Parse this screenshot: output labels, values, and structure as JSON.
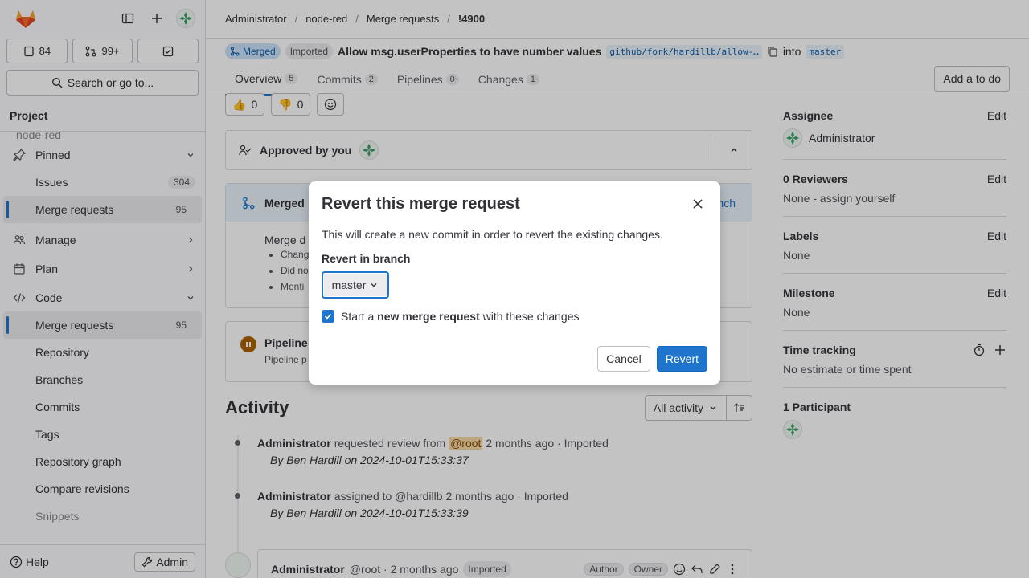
{
  "sidebar": {
    "counts": {
      "issues": "84",
      "merge_requests": "99+"
    },
    "search_label": "Search or go to...",
    "section": "Project",
    "faded_project": "node-red",
    "items": [
      {
        "label": "Pinned"
      },
      {
        "label": "Issues",
        "badge": "304"
      },
      {
        "label": "Merge requests",
        "badge": "95"
      },
      {
        "label": "Manage"
      },
      {
        "label": "Plan"
      },
      {
        "label": "Code"
      },
      {
        "label": "Merge requests",
        "badge": "95"
      },
      {
        "label": "Repository"
      },
      {
        "label": "Branches"
      },
      {
        "label": "Commits"
      },
      {
        "label": "Tags"
      },
      {
        "label": "Repository graph"
      },
      {
        "label": "Compare revisions"
      },
      {
        "label": "Snippets"
      }
    ],
    "help": "Help",
    "admin": "Admin"
  },
  "breadcrumb": [
    "Administrator",
    "node-red",
    "Merge requests",
    "!4900"
  ],
  "mr": {
    "status": "Merged",
    "imported": "Imported",
    "title": "Allow msg.userProperties to have number values",
    "source_branch": "github/fork/hardillb/allow-…",
    "into": "into",
    "target_branch": "master"
  },
  "tabs": [
    {
      "label": "Overview",
      "count": "5"
    },
    {
      "label": "Commits",
      "count": "2"
    },
    {
      "label": "Pipelines",
      "count": "0"
    },
    {
      "label": "Changes",
      "count": "1"
    }
  ],
  "todo_button": "Add a to do",
  "emoji": {
    "up": "0",
    "down": "0"
  },
  "approval": "Approved by you",
  "merged_card": {
    "title": "Merged",
    "link": "nch",
    "body": "Merge d",
    "bullets": [
      "Chang",
      "Did no",
      "Menti"
    ]
  },
  "pipeline": {
    "title": "Pipeline",
    "sub": "Pipeline p"
  },
  "activity": {
    "title": "Activity",
    "filter": "All activity",
    "items": [
      {
        "author": "Administrator",
        "action": "requested review from",
        "mention": "@root",
        "time": "2 months ago · Imported",
        "sub": "By Ben Hardill on 2024-10-01T15:33:37"
      },
      {
        "author": "Administrator",
        "action": "assigned to @hardillb",
        "mention": "",
        "time": "2 months ago · Imported",
        "sub": "By Ben Hardill on 2024-10-01T15:33:39"
      }
    ],
    "comment": {
      "author": "Administrator",
      "handle": "@root · 2 months ago",
      "badge": "Imported",
      "role1": "Author",
      "role2": "Owner"
    }
  },
  "right": {
    "assignee_title": "Assignee",
    "edit": "Edit",
    "assignee": "Administrator",
    "reviewers_title": "0 Reviewers",
    "reviewers": "None - assign yourself",
    "labels_title": "Labels",
    "labels": "None",
    "milestone_title": "Milestone",
    "milestone": "None",
    "time_title": "Time tracking",
    "time": "No estimate or time spent",
    "participants_title": "1 Participant"
  },
  "modal": {
    "title": "Revert this merge request",
    "description": "This will create a new commit in order to revert the existing changes.",
    "branch_label": "Revert in branch",
    "branch_value": "master",
    "checkbox_pre": "Start a ",
    "checkbox_bold": "new merge request",
    "checkbox_post": " with these changes",
    "checkbox_checked": true,
    "cancel": "Cancel",
    "revert": "Revert"
  }
}
